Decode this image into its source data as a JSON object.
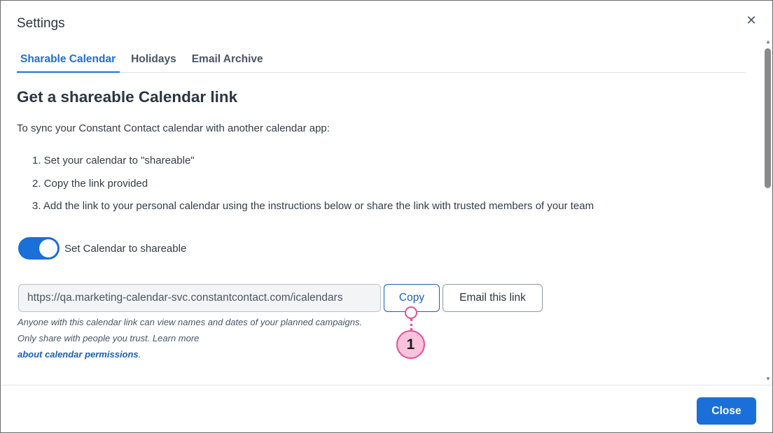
{
  "dialog": {
    "title": "Settings",
    "close_icon": "close-icon"
  },
  "tabs": [
    {
      "label": "Sharable Calendar",
      "active": true
    },
    {
      "label": "Holidays",
      "active": false
    },
    {
      "label": "Email Archive",
      "active": false
    }
  ],
  "content": {
    "heading": "Get a shareable Calendar link",
    "intro": "To sync your Constant Contact calendar with another calendar app:",
    "steps": [
      "1. Set your calendar to \"shareable\"",
      "2. Copy the link provided",
      "3. Add the link to your personal calendar using the instructions below or share the link with trusted members of your team"
    ],
    "toggle": {
      "label": "Set Calendar to shareable",
      "on": true
    },
    "link_field": {
      "value": "https://qa.marketing-calendar-svc.constantcontact.com/icalendars"
    },
    "copy_button": "Copy",
    "email_button": "Email this link",
    "helper_text": "Anyone with this calendar link can view names and dates of your planned campaigns. Only share with people you trust. Learn more ",
    "helper_link": "about calendar permissions",
    "helper_end": "."
  },
  "annotation": {
    "marker_label": "1"
  },
  "footer": {
    "close_button": "Close"
  },
  "colors": {
    "accent": "#1a6fd9",
    "marker": "#e64e96"
  }
}
